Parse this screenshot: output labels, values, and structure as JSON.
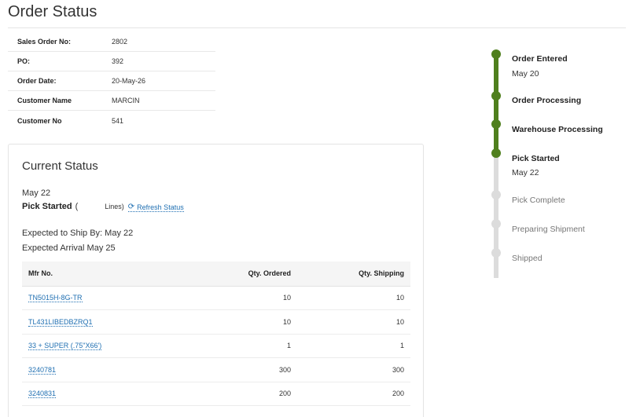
{
  "page": {
    "title": "Order Status"
  },
  "order_info": [
    {
      "label": "Sales Order No:",
      "value": "2802"
    },
    {
      "label": "PO:",
      "value": "392"
    },
    {
      "label": "Order Date:",
      "value": "20-May-26"
    },
    {
      "label": "Customer Name",
      "value": "MARCIN"
    },
    {
      "label": "Customer No",
      "value": "541"
    }
  ],
  "current_status": {
    "title": "Current Status",
    "date": "May 22",
    "status": "Pick Started",
    "paren_open": "(",
    "lines_text": "Lines)",
    "refresh_label": "Refresh Status",
    "ship_by": "Expected to Ship By: May 22",
    "arrival": "Expected Arrival May 25"
  },
  "items_table": {
    "headers": [
      "Mfr No.",
      "Qty. Ordered",
      "Qty. Shipping"
    ],
    "rows": [
      {
        "mfr": "TN5015H-8G-TR",
        "ordered": "10",
        "shipping": "10"
      },
      {
        "mfr": "TL431LIBEDBZRQ1",
        "ordered": "10",
        "shipping": "10"
      },
      {
        "mfr": "33 + SUPER (.75\"X66')",
        "ordered": "1",
        "shipping": "1"
      },
      {
        "mfr": "3240781",
        "ordered": "300",
        "shipping": "300"
      },
      {
        "mfr": "3240831",
        "ordered": "200",
        "shipping": "200"
      }
    ]
  },
  "timeline": {
    "colors": {
      "done": "#4f7f1d",
      "todo": "#dcdcdc"
    },
    "steps": [
      {
        "label": "Order Entered",
        "date": "May 20",
        "done": true
      },
      {
        "label": "Order Processing",
        "date": "",
        "done": true
      },
      {
        "label": "Warehouse Processing",
        "date": "",
        "done": true
      },
      {
        "label": "Pick Started",
        "date": "May 22",
        "done": true
      },
      {
        "label": "Pick Complete",
        "date": "",
        "done": false
      },
      {
        "label": "Preparing Shipment",
        "date": "",
        "done": false
      },
      {
        "label": "Shipped",
        "date": "",
        "done": false
      }
    ]
  },
  "icons": {
    "refresh": "refresh-icon"
  }
}
